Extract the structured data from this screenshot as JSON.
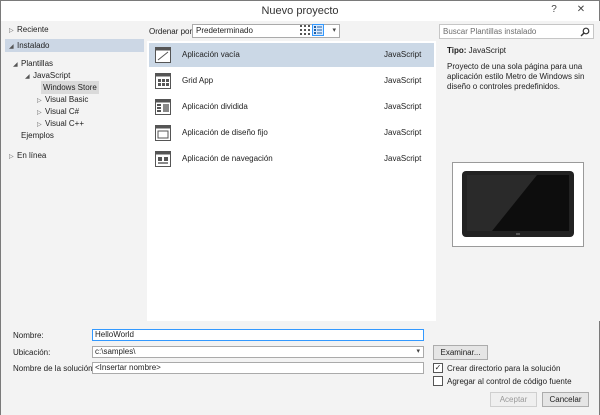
{
  "window": {
    "title": "Nuevo proyecto",
    "help_glyph": "?",
    "close_glyph": "✕"
  },
  "tree": {
    "reciente": "Reciente",
    "instalado": "Instalado",
    "plantillas": "Plantillas",
    "javascript": "JavaScript",
    "windows_store": "Windows Store",
    "visual_basic": "Visual Basic",
    "visual_csharp": "Visual C#",
    "visual_cpp": "Visual C++",
    "ejemplos": "Ejemplos",
    "en_linea": "En línea"
  },
  "toolbar": {
    "sort_label": "Ordenar por:",
    "sort_value": "Predeterminado"
  },
  "templates": [
    {
      "name": "Aplicación vacía",
      "language": "JavaScript",
      "icon": "blank-app-icon",
      "selected": true
    },
    {
      "name": "Grid App",
      "language": "JavaScript",
      "icon": "grid-app-icon",
      "selected": false
    },
    {
      "name": "Aplicación dividida",
      "language": "JavaScript",
      "icon": "split-app-icon",
      "selected": false
    },
    {
      "name": "Aplicación de diseño fijo",
      "language": "JavaScript",
      "icon": "fixed-layout-app-icon",
      "selected": false
    },
    {
      "name": "Aplicación de navegación",
      "language": "JavaScript",
      "icon": "navigation-app-icon",
      "selected": false
    }
  ],
  "details": {
    "search_placeholder": "Buscar Plantillas instalado",
    "tipo_label": "Tipo:",
    "tipo_value": "JavaScript",
    "description": "Proyecto de una sola página para una aplicación estilo Metro de Windows sin diseño o controles predefinidos."
  },
  "form": {
    "nombre_label": "Nombre:",
    "nombre_value": "HelloWorld",
    "ubicacion_label": "Ubicación:",
    "ubicacion_value": "c:\\samples\\",
    "solucion_label": "Nombre de la solución:",
    "solucion_value": "<Insertar nombre>",
    "examinar": "Examinar...",
    "crear_dir_label": "Crear directorio para la solución",
    "crear_dir_checked": true,
    "control_codigo_label": "Agregar al control de código fuente",
    "control_codigo_checked": false,
    "aceptar": "Aceptar",
    "cancelar": "Cancelar"
  },
  "colors": {
    "selection": "#cbd8e6",
    "accent": "#3399ff",
    "window_bg": "#f3f3f3"
  }
}
